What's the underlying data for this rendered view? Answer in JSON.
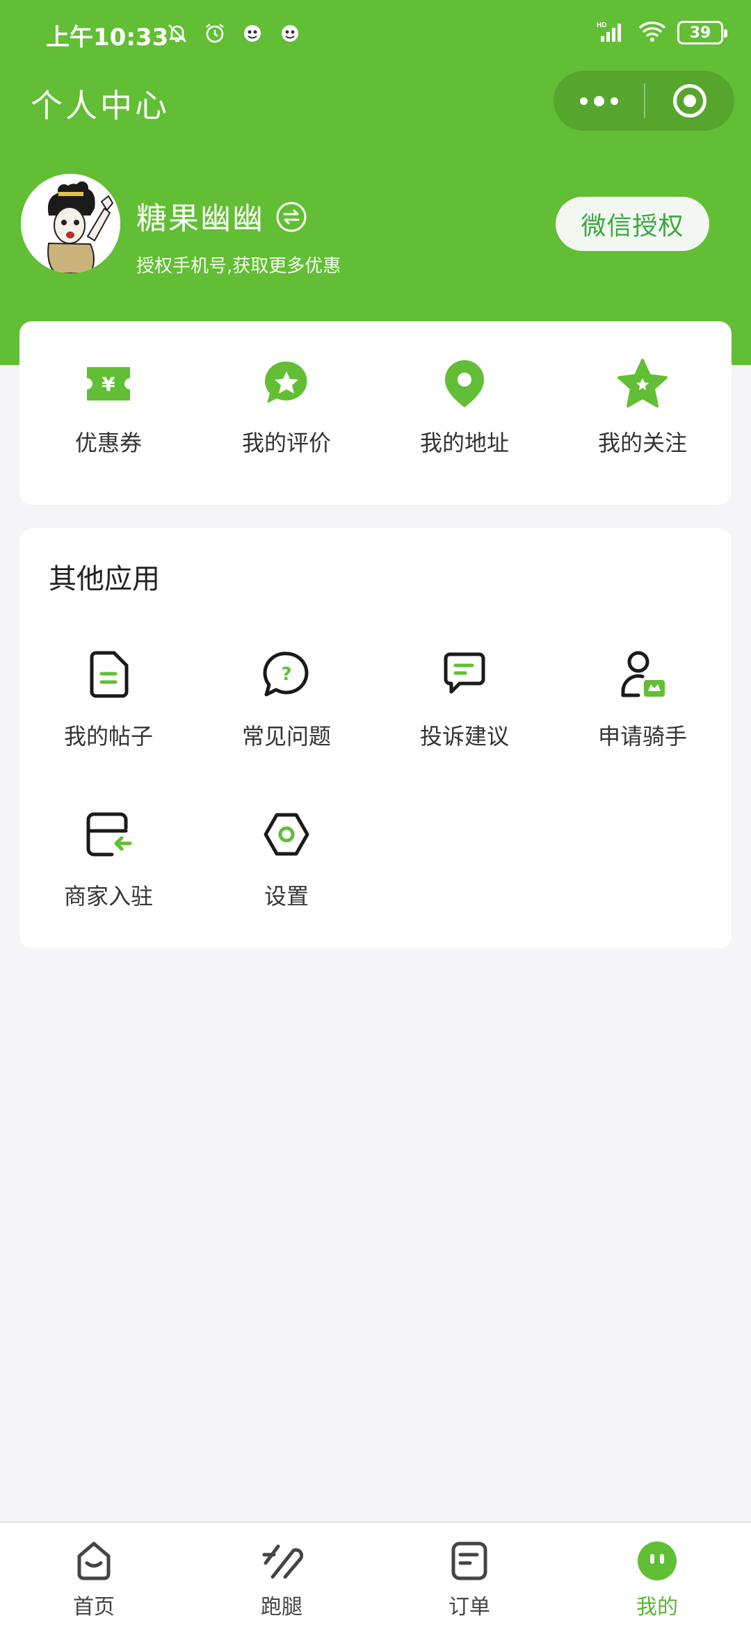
{
  "status_bar": {
    "time": "上午10:33",
    "battery": "39"
  },
  "header": {
    "title": "个人中心"
  },
  "profile": {
    "username": "糖果幽幽",
    "subtitle": "授权手机号,获取更多优惠",
    "auth_button": "微信授权"
  },
  "quick_links": [
    {
      "label": "优惠券",
      "icon": "coupon-icon"
    },
    {
      "label": "我的评价",
      "icon": "review-icon"
    },
    {
      "label": "我的地址",
      "icon": "location-icon"
    },
    {
      "label": "我的关注",
      "icon": "star-icon"
    }
  ],
  "other_apps": {
    "title": "其他应用",
    "items": [
      {
        "label": "我的帖子",
        "icon": "post-icon"
      },
      {
        "label": "常见问题",
        "icon": "faq-icon"
      },
      {
        "label": "投诉建议",
        "icon": "feedback-icon"
      },
      {
        "label": "申请骑手",
        "icon": "rider-apply-icon"
      },
      {
        "label": "商家入驻",
        "icon": "merchant-join-icon"
      },
      {
        "label": "设置",
        "icon": "settings-icon"
      }
    ]
  },
  "tabbar": {
    "items": [
      {
        "label": "首页",
        "icon": "home-icon",
        "active": false
      },
      {
        "label": "跑腿",
        "icon": "errand-icon",
        "active": false
      },
      {
        "label": "订单",
        "icon": "order-icon",
        "active": false
      },
      {
        "label": "我的",
        "icon": "profile-icon",
        "active": true
      }
    ]
  },
  "colors": {
    "brand_green": "#62be34",
    "active_tab": "#55b630",
    "page_bg": "#f5f5f7"
  }
}
